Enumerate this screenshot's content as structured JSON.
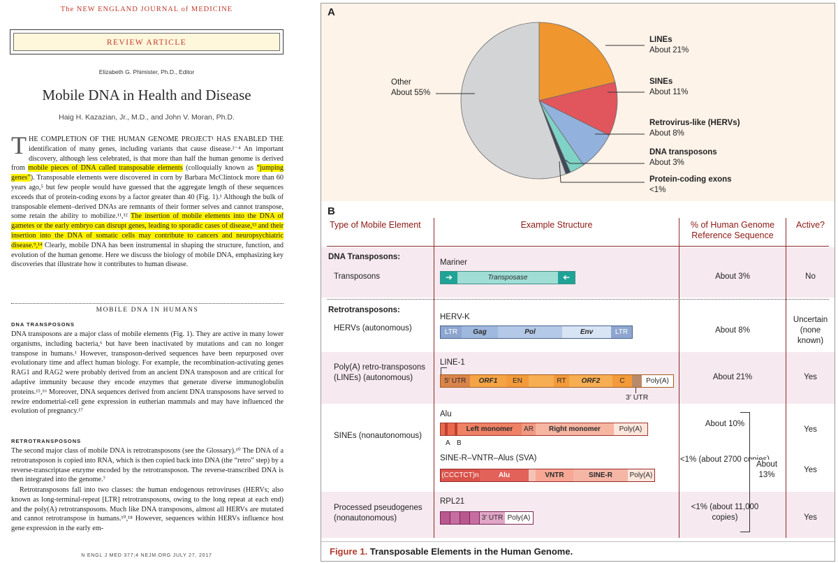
{
  "article": {
    "journal": "The NEW ENGLAND JOURNAL of MEDICINE",
    "article_type": "REVIEW ARTICLE",
    "editor": "Elizabeth G. Phimister, Ph.D., Editor",
    "title": "Mobile DNA in Health and Disease",
    "authors": "Haig H. Kazazian, Jr., M.D., and John V. Moran, Ph.D.",
    "dropcap": "T",
    "abstract_p1": "HE COMPLETION OF THE HUMAN GENOME PROJECT¹ HAS ENABLED THE identification of many genes, including variants that cause disease.²⁻⁴ An important discovery, although less celebrated, is that more than half the human genome is derived from ",
    "abstract_hl1": "mobile pieces of DNA called transposable elements",
    "abstract_p2": " (colloquially known as ",
    "abstract_hl2": "“jumping genes”",
    "abstract_p3": "). Transposable elements were discovered in corn by Barbara McClintock more than 60 years ago,⁵ but few people would have guessed that the aggregate length of these sequences exceeds that of protein-coding exons by a factor greater than 40 (Fig. 1).¹ Although the bulk of transposable element–derived DNAs are remnants of their former selves and cannot transpose, some retain the ability to mobilize.¹¹,¹² ",
    "abstract_hl3": "The insertion of mobile elements into the DNA of gametes or the early embryo can disrupt genes, leading to sporadic cases of disease,¹³ and their insertion into the DNA of somatic cells may contribute to cancers and neuropsychiatric disease.⁹,¹⁴",
    "abstract_p4": " Clearly, mobile DNA has been instrumental in shaping the structure, function, and evolution of the human genome. Here we discuss the biology of mobile DNA, emphasizing key discoveries that illustrate how it contributes to human disease.",
    "section_heading": "MOBILE DNA IN HUMANS",
    "sub1": "DNA TRANSPOSONS",
    "para1": "DNA transposons are a major class of mobile elements (Fig. 1). They are active in many lower organisms, including bacteria,⁶ but have been inactivated by mutations and can no longer transpose in humans.¹ However, transposon-derived sequences have been repurposed over evolutionary time and affect human biology. For example, the recombination-activating genes RAG1 and RAG2 were probably derived from an ancient DNA transposon and are critical for adaptive immunity because they encode enzymes that generate diverse immunoglobulin proteins.¹⁵,¹⁶ Moreover, DNA sequences derived from ancient DNA transposons have served to rewire endometrial-cell gene expression in eutherian mammals and may have influenced the evolution of pregnancy.¹⁷",
    "sub2": "RETROTRANSPOSONS",
    "para2": "The second major class of mobile DNA is retrotransposons (see the Glossary).¹⁰ The DNA of a retrotransposon is copied into RNA, which is then copied back into DNA (the “retro” step) by a reverse-transcriptase enzyme encoded by the retrotransposon. The reverse-transcribed DNA is then integrated into the genome.⁷",
    "para3": "Retrotransposons fall into two classes: the human endogenous retroviruses (HERVs; also known as long-terminal-repeat [LTR] retrotransposons, owing to the long repeat at each end) and the poly(A) retrotransposons. Much like DNA transposons, almost all HERVs are mutated and cannot retrotranspose in humans.¹⁰,¹⁸ However, sequences within HERVs influence host gene expression in the early em-",
    "footer": "N ENGL J MED 377;4   NEJM.ORG   JULY 27, 2017"
  },
  "figure": {
    "panel_a_label": "A",
    "panel_b_label": "B",
    "caption_prefix": "Figure 1.",
    "caption_text": " Transposable Elements in the Human Genome.",
    "pie_labels": {
      "lines_name": "LINEs",
      "lines_value": "About 21%",
      "sines_name": "SINEs",
      "sines_value": "About 11%",
      "hervs_name": "Retrovirus-like (HERVs)",
      "hervs_value": "About 8%",
      "dna_name": "DNA transposons",
      "dna_value": "About 3%",
      "exons_name": "Protein-coding exons",
      "exons_value": "<1%",
      "other_name": "Other",
      "other_value": "About 55%"
    },
    "table": {
      "col_type": "Type of Mobile Element",
      "col_structure": "Example Structure",
      "col_percent": "% of Human Genome Reference Sequence",
      "col_active": "Active?",
      "dna_group": "DNA Transposons:",
      "transposons_type": "Transposons",
      "mariner": "Mariner",
      "transposase": "Transposase",
      "transposons_pct": "About 3%",
      "transposons_active": "No",
      "retro_group": "Retrotransposons:",
      "hervs_type": "HERVs (autonomous)",
      "hervk": "HERV-K",
      "ltr": "LTR",
      "gag": "Gag",
      "pol": "Pol",
      "env": "Env",
      "hervs_pct": "About 8%",
      "hervs_active": "Uncertain (none known)",
      "lines_type": "Poly(A) retro-transposons (LINEs) (autonomous)",
      "line1": "LINE-1",
      "utr5": "5′ UTR",
      "orf1": "ORF1",
      "en": "EN",
      "rt": "RT",
      "orf2": "ORF2",
      "c": "C",
      "polya": "Poly(A)",
      "utr3": "3′ UTR",
      "lines_pct": "About 21%",
      "lines_active": "Yes",
      "sines_type": "SINEs (nonautonomous)",
      "alu": "Alu",
      "left_monomer": "Left monomer",
      "ar": "AR",
      "right_monomer": "Right monomer",
      "a_label": "A",
      "b_label": "B",
      "alu_pct": "About 10%",
      "alu_active": "Yes",
      "sva": "SINE-R–VNTR–Alus (SVA)",
      "cccctct": "(CCCTCT)n",
      "alu_seg": "Alu",
      "vntr": "VNTR",
      "siner": "SINE-R",
      "sva_pct": "<1% (about 2700 copies)",
      "sva_active": "Yes",
      "sines_total": "About 13%",
      "pseudo_type": "Processed pseudogenes (nonautonomous)",
      "rpl21": "RPL21",
      "utr3b": "3′ UTR",
      "pseudo_pct": "<1% (about 11,000 copies)",
      "pseudo_active": "Yes"
    }
  },
  "chart_data": {
    "type": "pie",
    "title": "",
    "slices": [
      {
        "label": "LINEs",
        "value": 21,
        "color": "#f0962f"
      },
      {
        "label": "SINEs",
        "value": 11,
        "color": "#e0565c"
      },
      {
        "label": "Retrovirus-like (HERVs)",
        "value": 8,
        "color": "#92b2dd"
      },
      {
        "label": "DNA transposons",
        "value": 3,
        "color": "#7fd2c6"
      },
      {
        "label": "Protein-coding exons",
        "value": 1,
        "color": "#404a59"
      },
      {
        "label": "Other",
        "value": 55,
        "color": "#d3d4d6"
      }
    ]
  }
}
